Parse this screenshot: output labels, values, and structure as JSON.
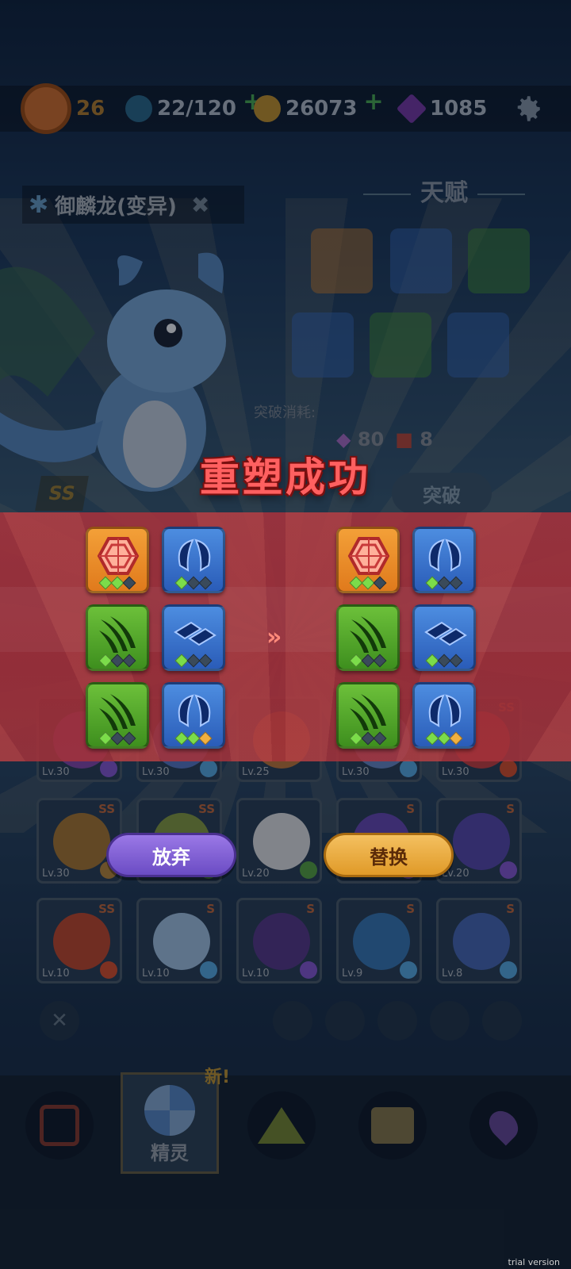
{
  "topbar": {
    "level": "26",
    "stamina": "22/120",
    "coins": "26073",
    "gems": "1085"
  },
  "pet": {
    "name": "御麟龙(变异)",
    "grade": "SS"
  },
  "talent": {
    "title": "天赋"
  },
  "breakthrough": {
    "label": "突破消耗:",
    "gem_cost": "80",
    "item_cost": "8",
    "button": "突破"
  },
  "roster": {
    "rows": [
      [
        {
          "lv": "Lv.30",
          "grade": "",
          "element": "lightning"
        },
        {
          "lv": "Lv.30",
          "grade": "",
          "element": "ice"
        },
        {
          "lv": "Lv.25",
          "grade": "",
          "element": ""
        },
        {
          "lv": "Lv.30",
          "grade": "",
          "element": "ice"
        },
        {
          "lv": "Lv.30",
          "grade": "SS",
          "element": "fire"
        }
      ],
      [
        {
          "lv": "Lv.30",
          "grade": "SS",
          "element": "earth"
        },
        {
          "lv": "",
          "grade": "SS",
          "element": "grass"
        },
        {
          "lv": "Lv.20",
          "grade": "",
          "element": "grass"
        },
        {
          "lv": "",
          "grade": "S",
          "element": "lightning"
        },
        {
          "lv": "Lv.20",
          "grade": "S",
          "element": "lightning"
        }
      ],
      [
        {
          "lv": "Lv.10",
          "grade": "SS",
          "element": "fire"
        },
        {
          "lv": "Lv.10",
          "grade": "S",
          "element": "ice"
        },
        {
          "lv": "Lv.10",
          "grade": "S",
          "element": "lightning"
        },
        {
          "lv": "Lv.9",
          "grade": "S",
          "element": "ice"
        },
        {
          "lv": "Lv.8",
          "grade": "S",
          "element": "ice"
        }
      ]
    ]
  },
  "nav": {
    "new_tag": "新!",
    "selected_label": "精灵"
  },
  "dialog": {
    "title": "重塑成功",
    "arrow": "»",
    "old_talents": [
      {
        "type": "orange",
        "icon": "gem-icon",
        "dots": [
          "on",
          "on",
          "off"
        ]
      },
      {
        "type": "blue",
        "icon": "feather-icon",
        "dots": [
          "on",
          "off",
          "off"
        ]
      },
      {
        "type": "green",
        "icon": "claw-icon",
        "dots": [
          "on",
          "off",
          "off"
        ]
      },
      {
        "type": "blue",
        "icon": "scale-icon",
        "dots": [
          "on",
          "off",
          "off"
        ]
      },
      {
        "type": "green",
        "icon": "claw-icon",
        "dots": [
          "on",
          "off",
          "off"
        ]
      },
      {
        "type": "blue",
        "icon": "feather-icon",
        "dots": [
          "on",
          "on",
          "gold"
        ]
      }
    ],
    "new_talents": [
      {
        "type": "orange",
        "icon": "gem-icon",
        "dots": [
          "on",
          "on",
          "off"
        ]
      },
      {
        "type": "blue",
        "icon": "feather-icon",
        "dots": [
          "on",
          "off",
          "off"
        ]
      },
      {
        "type": "green",
        "icon": "claw-icon",
        "dots": [
          "on",
          "off",
          "off"
        ]
      },
      {
        "type": "blue",
        "icon": "scale-icon",
        "dots": [
          "on",
          "off",
          "off"
        ]
      },
      {
        "type": "green",
        "icon": "claw-icon",
        "dots": [
          "on",
          "off",
          "off"
        ]
      },
      {
        "type": "blue",
        "icon": "feather-icon",
        "dots": [
          "on",
          "on",
          "gold"
        ]
      }
    ],
    "giveup_label": "放弃",
    "replace_label": "替换"
  },
  "watermark": "trial version",
  "colors": {
    "title_red": "#ff6060",
    "band_red": "#a8323c",
    "giveup_purple": "#7c5cd4",
    "replace_gold": "#eaa838"
  }
}
